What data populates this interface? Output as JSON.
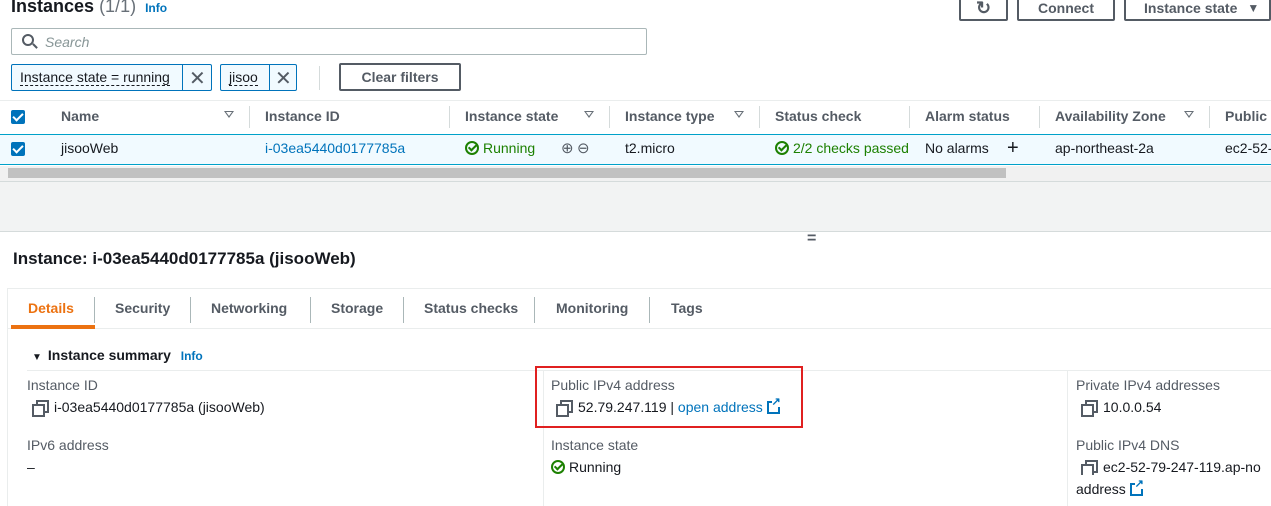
{
  "header": {
    "title": "Instances",
    "count": "(1/1)",
    "info": "Info",
    "refresh_icon": "refresh-icon",
    "connect_label": "Connect",
    "instance_state_label": "Instance state"
  },
  "search": {
    "placeholder": "Search"
  },
  "filters": {
    "tokens": [
      "Instance state = running",
      "jisoo"
    ],
    "clear_label": "Clear filters"
  },
  "table": {
    "columns": [
      "Name",
      "Instance ID",
      "Instance state",
      "Instance type",
      "Status check",
      "Alarm status",
      "Availability Zone",
      "Public"
    ],
    "row": {
      "name": "jisooWeb",
      "instance_id": "i-03ea5440d0177785a",
      "state": "Running",
      "type": "t2.micro",
      "status_check": "2/2 checks passed",
      "alarm": "No alarms",
      "az": "ap-northeast-2a",
      "public": "ec2-52-"
    }
  },
  "divider_handle": "=",
  "detail": {
    "title": "Instance: i-03ea5440d0177785a (jisooWeb)",
    "tabs": [
      "Details",
      "Security",
      "Networking",
      "Storage",
      "Status checks",
      "Monitoring",
      "Tags"
    ],
    "active_tab": "Details",
    "summary_title": "Instance summary",
    "summary_info": "Info",
    "fields": {
      "instance_id_label": "Instance ID",
      "instance_id_value": "i-03ea5440d0177785a (jisooWeb)",
      "public_ipv4_label": "Public IPv4 address",
      "public_ipv4_value": "52.79.247.119",
      "public_ipv4_sep": "|",
      "open_address": "open address",
      "private_ipv4_label": "Private IPv4 addresses",
      "private_ipv4_value": "10.0.0.54",
      "ipv6_label": "IPv6 address",
      "ipv6_value": "–",
      "instance_state_label": "Instance state",
      "instance_state_value": "Running",
      "public_dns_label": "Public IPv4 DNS",
      "public_dns_value": "ec2-52-79-247-119.ap-no",
      "public_dns_link": "address"
    }
  },
  "colors": {
    "link": "#0073bb",
    "success": "#1d8102",
    "active_tab": "#ec7211",
    "highlight_box": "#e02020",
    "selected_row": "#f1faff"
  }
}
